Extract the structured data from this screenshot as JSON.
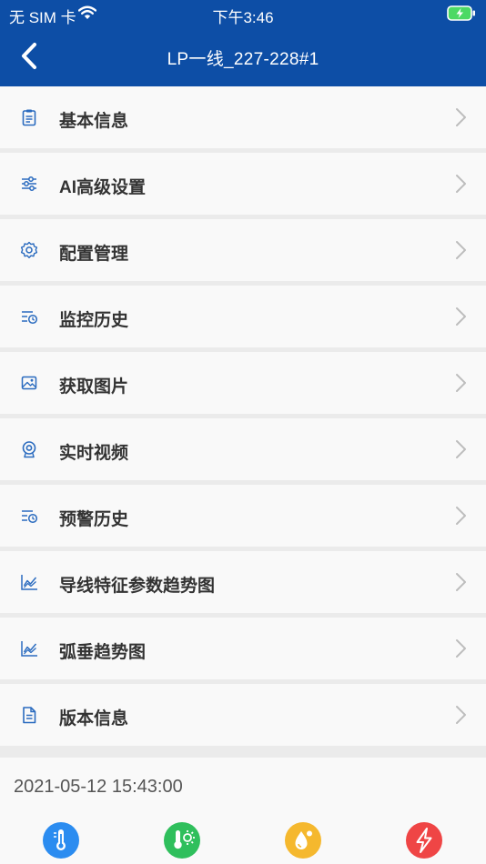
{
  "status_bar": {
    "carrier": "无 SIM 卡",
    "time": "下午3:46"
  },
  "nav": {
    "title": "LP一线_227-228#1"
  },
  "menu": [
    {
      "label": "基本信息",
      "icon": "clipboard-icon"
    },
    {
      "label": "AI高级设置",
      "icon": "sliders-icon"
    },
    {
      "label": "配置管理",
      "icon": "gear-icon"
    },
    {
      "label": "监控历史",
      "icon": "history-list-icon"
    },
    {
      "label": "获取图片",
      "icon": "image-icon"
    },
    {
      "label": "实时视频",
      "icon": "camera-icon"
    },
    {
      "label": "预警历史",
      "icon": "history-list-icon"
    },
    {
      "label": "导线特征参数趋势图",
      "icon": "line-chart-icon"
    },
    {
      "label": "弧垂趋势图",
      "icon": "line-chart-icon"
    },
    {
      "label": "版本信息",
      "icon": "document-icon"
    }
  ],
  "bottom": {
    "timestamp": "2021-05-12 15:43:00",
    "sensors": [
      {
        "icon": "thermometer-icon",
        "color": "#2b8cf0"
      },
      {
        "icon": "temperature-sun-icon",
        "color": "#2fbf5c"
      },
      {
        "icon": "humidity-drop-icon",
        "color": "#f5b82e"
      },
      {
        "icon": "lightning-icon",
        "color": "#ef4545"
      }
    ]
  },
  "colors": {
    "header": "#0d4ea6",
    "icon": "#2a6bbf",
    "chevron": "#bdbdbd"
  }
}
